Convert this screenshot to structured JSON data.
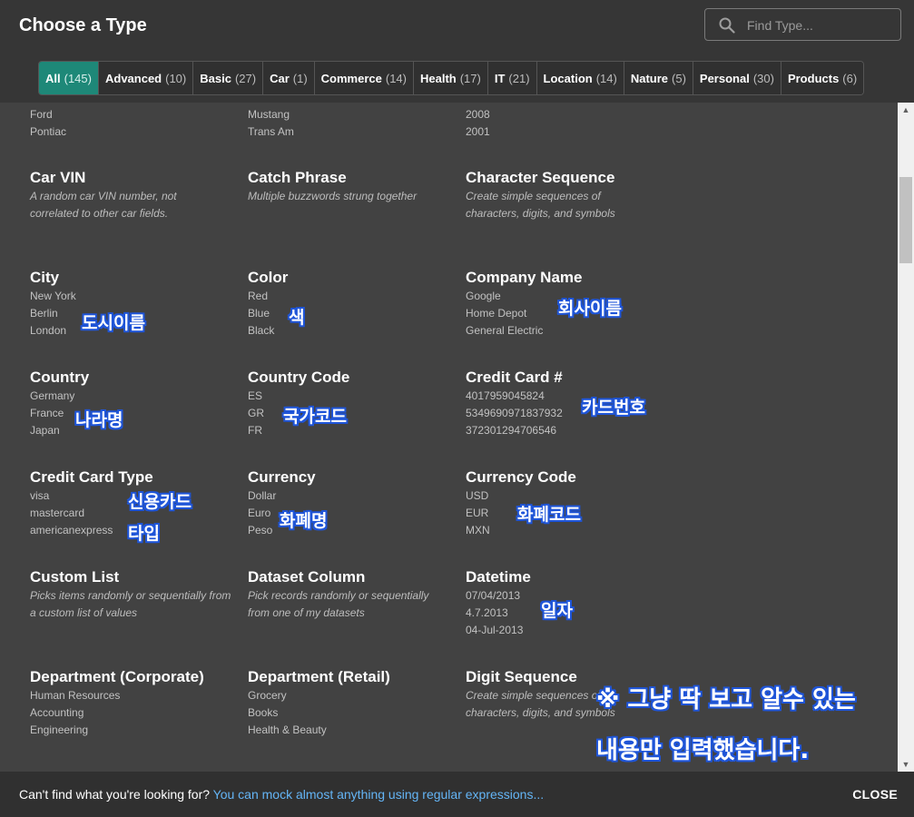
{
  "header": {
    "title": "Choose a Type",
    "search_placeholder": "Find Type..."
  },
  "tabs": [
    {
      "label": "All",
      "count": "(145)",
      "active": true
    },
    {
      "label": "Advanced",
      "count": "(10)"
    },
    {
      "label": "Basic",
      "count": "(27)"
    },
    {
      "label": "Car",
      "count": "(1)"
    },
    {
      "label": "Commerce",
      "count": "(14)"
    },
    {
      "label": "Health",
      "count": "(17)"
    },
    {
      "label": "IT",
      "count": "(21)"
    },
    {
      "label": "Location",
      "count": "(14)"
    },
    {
      "label": "Nature",
      "count": "(5)"
    },
    {
      "label": "Personal",
      "count": "(30)"
    },
    {
      "label": "Products",
      "count": "(6)"
    }
  ],
  "partial_row": {
    "col1": [
      "Ford",
      "Pontiac"
    ],
    "col2": [
      "Mustang",
      "Trans Am"
    ],
    "col3": [
      "2008",
      "2001"
    ]
  },
  "cards": {
    "car_vin": {
      "name": "Car VIN",
      "desc": "A random car VIN number, not correlated to other car fields."
    },
    "catch_phrase": {
      "name": "Catch Phrase",
      "desc": "Multiple buzzwords strung together"
    },
    "character_sequence": {
      "name": "Character Sequence",
      "desc": "Create simple sequences of characters, digits, and symbols"
    },
    "city": {
      "name": "City",
      "examples": [
        "New York",
        "Berlin",
        "London"
      ]
    },
    "color": {
      "name": "Color",
      "examples": [
        "Red",
        "Blue",
        "Black"
      ]
    },
    "company_name": {
      "name": "Company Name",
      "examples": [
        "Google",
        "Home Depot",
        "General Electric"
      ]
    },
    "country": {
      "name": "Country",
      "examples": [
        "Germany",
        "France",
        "Japan"
      ]
    },
    "country_code": {
      "name": "Country Code",
      "examples": [
        "ES",
        "GR",
        "FR"
      ]
    },
    "credit_card": {
      "name": "Credit Card #",
      "examples": [
        "4017959045824",
        "5349690971837932",
        "372301294706546"
      ]
    },
    "credit_card_type": {
      "name": "Credit Card Type",
      "examples": [
        "visa",
        "mastercard",
        "americanexpress"
      ]
    },
    "currency": {
      "name": "Currency",
      "examples": [
        "Dollar",
        "Euro",
        "Peso"
      ]
    },
    "currency_code": {
      "name": "Currency Code",
      "examples": [
        "USD",
        "EUR",
        "MXN"
      ]
    },
    "custom_list": {
      "name": "Custom List",
      "desc": "Picks items randomly or sequentially from a custom list of values"
    },
    "dataset_column": {
      "name": "Dataset Column",
      "desc": "Pick records randomly or sequentially from one of my datasets"
    },
    "datetime": {
      "name": "Datetime",
      "examples": [
        "07/04/2013",
        "4.7.2013",
        "04-Jul-2013"
      ]
    },
    "department_corporate": {
      "name": "Department (Corporate)",
      "examples": [
        "Human Resources",
        "Accounting",
        "Engineering"
      ]
    },
    "department_retail": {
      "name": "Department (Retail)",
      "examples": [
        "Grocery",
        "Books",
        "Health & Beauty"
      ]
    },
    "digit_sequence": {
      "name": "Digit Sequence",
      "desc": "Create simple sequences of characters, digits, and symbols"
    }
  },
  "annotations": {
    "city": "도시이름",
    "color": "색",
    "company": "회사이름",
    "country": "나라명",
    "country_code": "국가코드",
    "card_number": "카드번호",
    "card_type_1": "신용카드",
    "card_type_2": "타입",
    "currency": "화폐명",
    "currency_code": "화폐코드",
    "date": "일자",
    "note_1": "※ 그냥 딱 보고 알수 있는",
    "note_2": "내용만 입력했습니다."
  },
  "footer": {
    "prefix": "Can't find what you're looking for?",
    "link": "You can mock almost anything using regular expressions...",
    "close": "CLOSE"
  }
}
